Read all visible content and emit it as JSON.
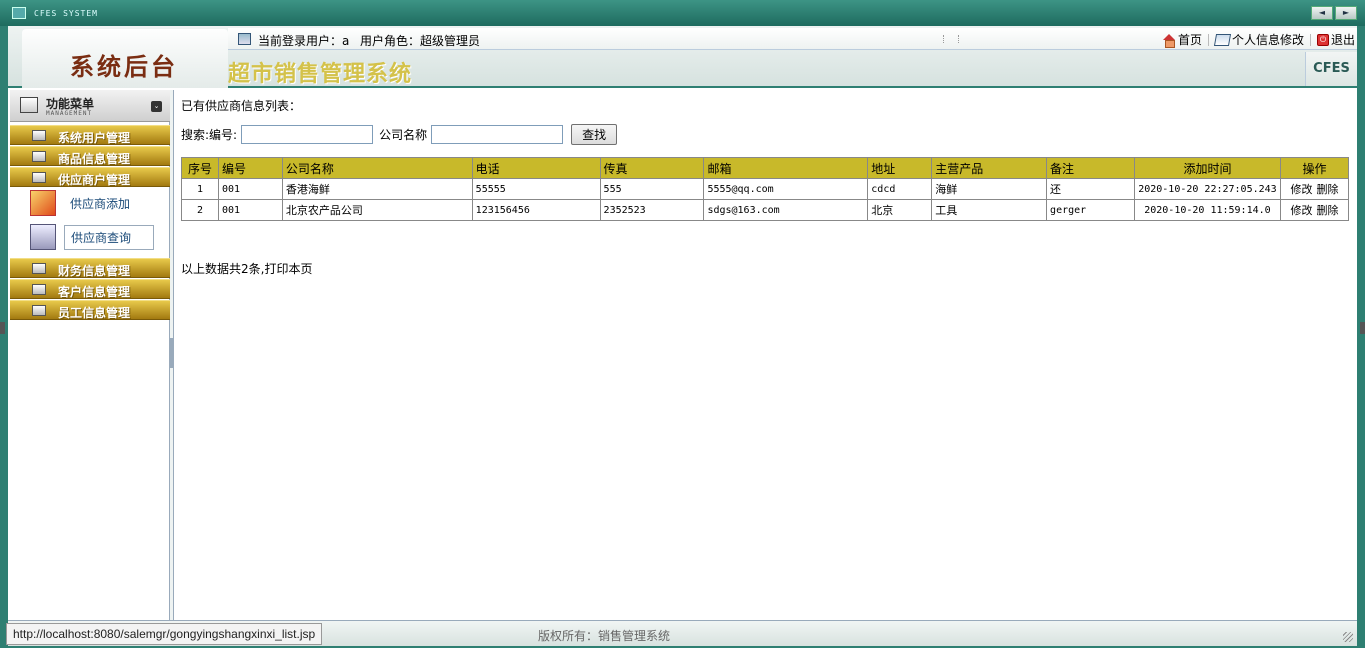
{
  "window": {
    "app_title": "CFES SYSTEM",
    "prev_label": "◄",
    "next_label": "►"
  },
  "header": {
    "logo_text": "系统后台",
    "current_user": "当前登录用户：a",
    "user_role": "用户角色：超级管理员",
    "system_title": "超市销售管理系统",
    "badge": "CFES",
    "links": {
      "home": "首页",
      "profile": "个人信息修改",
      "logout": "退出"
    }
  },
  "sidebar": {
    "title": "功能菜单",
    "subtitle": "MANAGEMENT",
    "groups_top": [
      {
        "label": "系统用户管理"
      },
      {
        "label": "商品信息管理"
      },
      {
        "label": "供应商户管理"
      }
    ],
    "sub_items": [
      {
        "label": "供应商添加"
      },
      {
        "label": "供应商查询"
      }
    ],
    "groups_bottom": [
      {
        "label": "财务信息管理"
      },
      {
        "label": "客户信息管理"
      },
      {
        "label": "员工信息管理"
      }
    ]
  },
  "content": {
    "heading": "已有供应商信息列表：",
    "search": {
      "label_prefix": "搜索:编号:",
      "code_value": "",
      "company_label": "公司名称",
      "company_value": "",
      "button": "查找"
    },
    "table": {
      "headers": [
        "序号",
        "编号",
        "公司名称",
        "电话",
        "传真",
        "邮箱",
        "地址",
        "主营产品",
        "备注",
        "添加时间",
        "操作"
      ],
      "rows": [
        {
          "seq": "1",
          "code": "001",
          "company": "香港海鲜",
          "phone": "55555",
          "fax": "555",
          "email": "5555@qq.com",
          "address": "cdcd",
          "product": "海鲜",
          "remark": "还",
          "added": "2020-10-20 22:27:05.243",
          "edit": "修改",
          "del": "删除"
        },
        {
          "seq": "2",
          "code": "001",
          "company": "北京农产品公司",
          "phone": "123156456",
          "fax": "2352523",
          "email": "sdgs@163.com",
          "address": "北京",
          "product": "工具",
          "remark": "gerger",
          "added": "2020-10-20 11:59:14.0",
          "edit": "修改",
          "del": "删除"
        }
      ]
    },
    "footer_text": "以上数据共2条,",
    "print_label": "打印本页"
  },
  "statusbar": {
    "copyright": "版权所有：销售管理系统",
    "url": "http://localhost:8080/salemgr/gongyingshangxinxi_list.jsp"
  }
}
